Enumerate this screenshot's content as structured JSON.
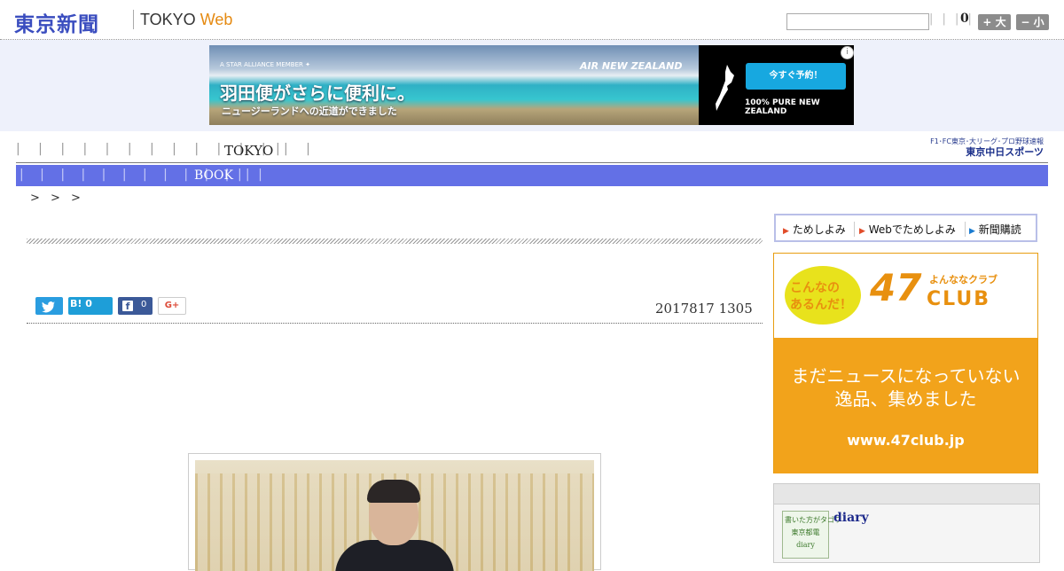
{
  "header": {
    "logo_text": "東京新聞",
    "logo_web_a": "TOKYO ",
    "logo_web_b": "Web",
    "search_placeholder": "",
    "bars": "| | | |",
    "count": "0",
    "font_large": "+ 大",
    "font_small": "− 小"
  },
  "ad": {
    "alliance": "A STAR ALLIANCE MEMBER ✦",
    "airline": "AIR NEW ZEALAND",
    "headline": "羽田便がさらに便利に。",
    "subline": "ニュージーランドへの近道ができました",
    "cta": "今すぐ予約！",
    "pure": "100% PURE NEW ZEALAND",
    "info": "i"
  },
  "nav": {
    "primary_bars": "| | | | | | | | | | | | | |",
    "primary_item": "TOKYO",
    "primary_tail": "|",
    "sports_line1": "F1･FC東京･大リーグ･プロ野球速報",
    "sports_line2": "東京中日スポーツ",
    "secondary_bars": "| | | | | | | | | | | |",
    "secondary_item": "BOOK",
    "secondary_tail": "| |"
  },
  "breadcrumb": "> > >",
  "article": {
    "date": "2017817 1305",
    "hatena": "B! 0",
    "fb_count": "0",
    "gplus": "G+"
  },
  "sidebar": {
    "tab1": "ためしよみ",
    "tab2": "Webでためしよみ",
    "tab3": "新聞購読",
    "club": {
      "konna": "こんなの\nあるんだ！",
      "num": "47",
      "yonana": "よんななクラブ",
      "club": "CLUB",
      "msg": "まだニュースになっていない\n逸品、集めました",
      "url": "www.47club.jp"
    },
    "diary": {
      "thumb": "書いた方がタゴワ\n東京都電\ndiary",
      "title": "diary"
    }
  },
  "colors": {
    "brand": "#3a4dbf",
    "nav_blue": "#6370e6",
    "club_orange": "#f2a31b"
  }
}
